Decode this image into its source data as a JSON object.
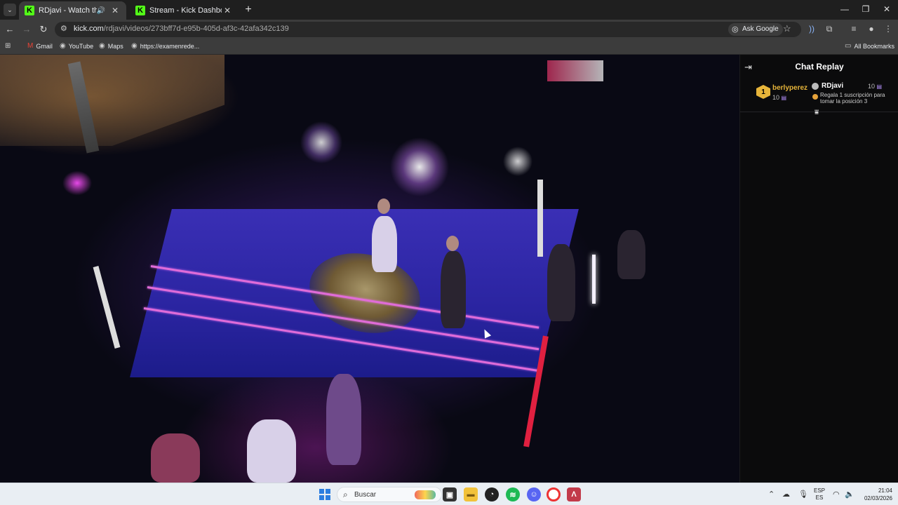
{
  "browser": {
    "tabs": [
      {
        "title": "RDjavi - Watch the VOD on",
        "active": true,
        "audio": true
      },
      {
        "title": "Stream - Kick Dashboard",
        "active": false,
        "audio": false
      }
    ],
    "url_host": "kick.com",
    "url_path": "/rdjavi/videos/273bff7d-e95b-405d-af3c-42afa342c139",
    "ask_google": "Ask Google",
    "bookmarks": [
      "Gmail",
      "YouTube",
      "Maps",
      "https://examenrede..."
    ],
    "all_bookmarks": "All Bookmarks"
  },
  "chat": {
    "title": "Chat Replay",
    "pinned": {
      "rank": "1",
      "gifter": "berlyperez",
      "gifter_count": "10",
      "streamer": "RDjavi",
      "streamer_count": "10",
      "message": "Regala 1 suscripción para tomar la posición 3"
    }
  },
  "taskbar": {
    "search_label": "Buscar",
    "lang_top": "ESP",
    "lang_bottom": "ES",
    "time": "21:04",
    "date": "02/03/2026"
  },
  "colors": {
    "kick_green": "#53fc18",
    "gold": "#e7b53a",
    "gift_purple": "#b792ff"
  }
}
